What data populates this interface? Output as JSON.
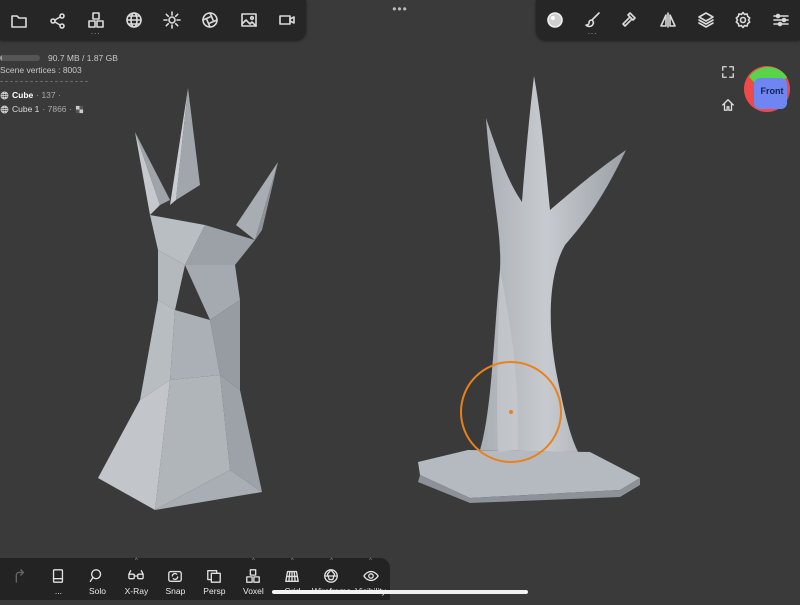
{
  "colors": {
    "background": "#3a3a3a",
    "toolbar": "#262626",
    "mesh": "#aeb4ba",
    "brush_ring": "#e8821c",
    "gizmo_front": "#6f86f2",
    "gizmo_top": "#58d448",
    "gizmo_side": "#ef4a4a"
  },
  "top_toolbar_left": [
    {
      "id": "files",
      "icon": "folder-icon",
      "more": false
    },
    {
      "id": "scene",
      "icon": "nodes-icon",
      "more": false
    },
    {
      "id": "tools",
      "icon": "cubes-icon",
      "more": true,
      "more_label": "..."
    },
    {
      "id": "topology",
      "icon": "mesh-sphere-icon",
      "more": false
    },
    {
      "id": "lighting",
      "icon": "sun-icon",
      "more": false
    },
    {
      "id": "camera",
      "icon": "aperture-icon",
      "more": false
    },
    {
      "id": "background",
      "icon": "image-icon",
      "more": false
    },
    {
      "id": "record",
      "icon": "video-camera-icon",
      "more": false
    }
  ],
  "menu_dots": "•••",
  "top_toolbar_right": [
    {
      "id": "material",
      "icon": "material-sphere-icon",
      "more": false
    },
    {
      "id": "brush",
      "icon": "brush-icon",
      "more": true,
      "more_label": "..."
    },
    {
      "id": "stroke",
      "icon": "hammer-icon",
      "more": false
    },
    {
      "id": "symmetry",
      "icon": "symmetry-icon",
      "more": false
    },
    {
      "id": "layers",
      "icon": "layers-icon",
      "more": false
    },
    {
      "id": "settings",
      "icon": "gear-icon",
      "more": false
    },
    {
      "id": "sliders",
      "icon": "sliders-icon",
      "more": false
    }
  ],
  "info": {
    "memory": "90.7 MB / 1.87 GB",
    "memory_fraction": 0.05,
    "vertices_label": "Scene vertices : 8003",
    "objects": [
      {
        "name": "Cube",
        "count": "· 137 ·",
        "bold": true,
        "icon": "mesh-sphere-icon",
        "flag": ""
      },
      {
        "name": "Cube 1",
        "count": "· 7866 ·",
        "bold": false,
        "icon": "mesh-sphere-icon",
        "flag": "checker-icon"
      }
    ]
  },
  "gizmo": {
    "label": "Front"
  },
  "bottom_toolbar": [
    {
      "id": "redo",
      "label": "",
      "icon": "redo-icon",
      "disabled": true,
      "caret": false
    },
    {
      "id": "history",
      "label": "...",
      "icon": "history-icon",
      "disabled": false,
      "caret": false
    },
    {
      "id": "solo",
      "label": "Solo",
      "icon": "magnifier-icon",
      "disabled": false,
      "caret": false
    },
    {
      "id": "xray",
      "label": "X-Ray",
      "icon": "glasses-icon",
      "disabled": false,
      "caret": true
    },
    {
      "id": "snap",
      "label": "Snap",
      "icon": "camera-snap-icon",
      "disabled": false,
      "caret": false
    },
    {
      "id": "persp",
      "label": "Persp",
      "icon": "perspective-icon",
      "disabled": false,
      "caret": false
    },
    {
      "id": "voxel",
      "label": "Voxel",
      "icon": "cubes-icon",
      "disabled": false,
      "caret": true
    },
    {
      "id": "grid",
      "label": "Grid",
      "icon": "grid-icon",
      "disabled": false,
      "caret": true
    },
    {
      "id": "wireframe",
      "label": "Wireframe",
      "icon": "wire-sphere-icon",
      "disabled": false,
      "caret": true
    },
    {
      "id": "visibility",
      "label": "Visibility",
      "icon": "eye-icon",
      "disabled": false,
      "caret": true
    }
  ],
  "bottom_caret": "^"
}
